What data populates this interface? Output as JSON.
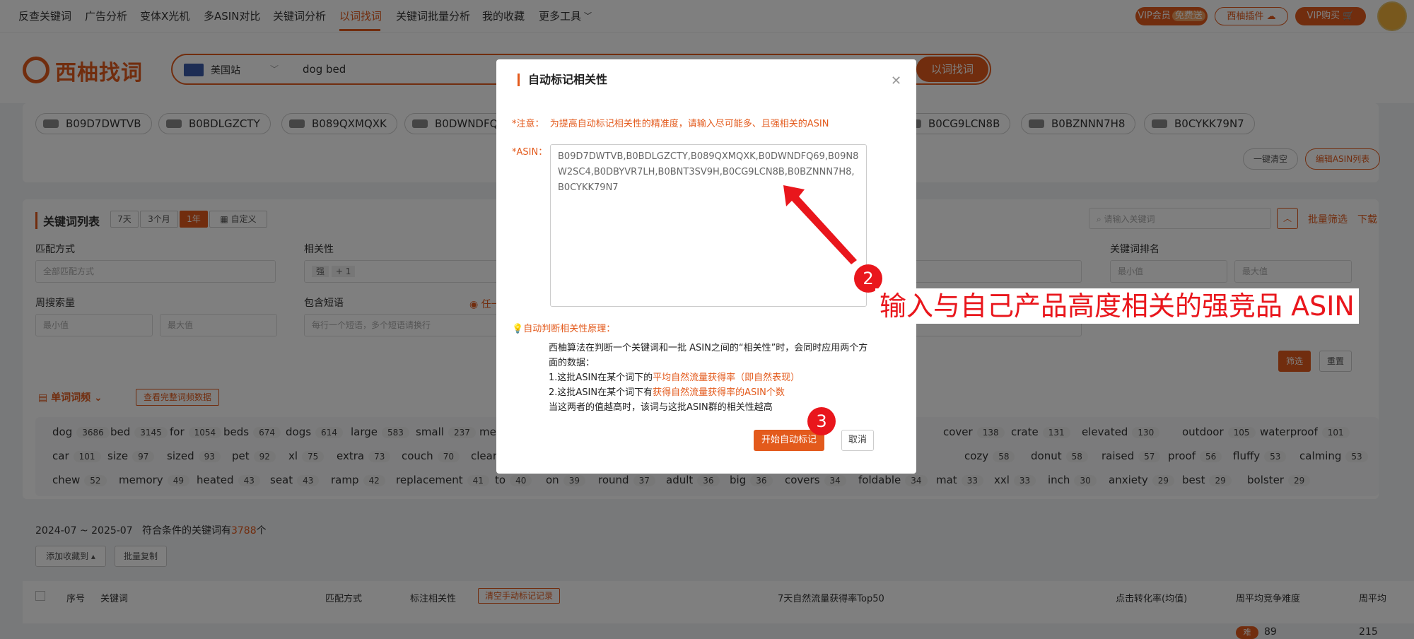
{
  "nav": {
    "items": [
      "反查关键词",
      "广告分析",
      "变体X光机",
      "多ASIN对比",
      "关键词分析",
      "以词找词",
      "关键词批量分析",
      "我的收藏",
      "更多工具"
    ],
    "vip_gift": "VIP会员",
    "vip_gift_badge": "免费送",
    "plugin": "西柚插件",
    "vip_buy": "VIP购买"
  },
  "header": {
    "logo_text": "西柚找词",
    "site": "美国站",
    "search_value": "dog bed",
    "search_button": "以词找词"
  },
  "asins": [
    "B09D7DWTVB",
    "B0BDLGZCTY",
    "B089QXMQXK",
    "B0DWNDFQ69",
    "B0CG9LCN8B",
    "B0BZNNN7H8",
    "B0CYKK79N7"
  ],
  "asin_actions": {
    "clear": "一键清空",
    "edit": "编辑ASIN列表"
  },
  "keyword_section": {
    "title": "关键词列表",
    "ranges": [
      "7天",
      "3个月",
      "1年",
      "自定义"
    ],
    "search_placeholder": "请输入关键词",
    "batch_filter": "批量筛选",
    "download": "下载",
    "match_label": "匹配方式",
    "match_value": "全部匹配方式",
    "relevance_label": "相关性",
    "relevance_tag": "强",
    "relevance_more": "+ 1",
    "rank_label": "关键词排名",
    "min_placeholder": "最小值",
    "max_placeholder": "最大值",
    "weekly_label": "周搜索量",
    "phrase_label": "包含短语",
    "phrase_placeholder": "每行一个短语，多个短语请换行",
    "radio_any": "任一",
    "filter_button": "筛选",
    "reset_button": "重置"
  },
  "word_freq": {
    "tab": "单词词频",
    "full_link": "查看完整词频数据",
    "rows": [
      [
        [
          "dog",
          "3686"
        ],
        [
          "bed",
          "3145"
        ],
        [
          "for",
          "1054"
        ],
        [
          "beds",
          "674"
        ],
        [
          "dogs",
          "614"
        ],
        [
          "large",
          "583"
        ],
        [
          "small",
          "237"
        ],
        [
          "me",
          ""
        ]
      ],
      [
        [
          "car",
          "101"
        ],
        [
          "size",
          "97"
        ],
        [
          "sized",
          "93"
        ],
        [
          "pet",
          "92"
        ],
        [
          "xl",
          "75"
        ],
        [
          "extra",
          "73"
        ],
        [
          "couch",
          "70"
        ],
        [
          "clear",
          ""
        ]
      ],
      [
        [
          "chew",
          "52"
        ],
        [
          "memory",
          "49"
        ],
        [
          "heated",
          "43"
        ],
        [
          "seat",
          "43"
        ],
        [
          "ramp",
          "42"
        ],
        [
          "replacement",
          "41"
        ],
        [
          "to",
          "40"
        ],
        [
          "on",
          "39"
        ],
        [
          "round",
          "37"
        ],
        [
          "adult",
          "36"
        ],
        [
          "big",
          "36"
        ],
        [
          "covers",
          "34"
        ],
        [
          "foldable",
          "34"
        ],
        [
          "mat",
          "33"
        ],
        [
          "xxl",
          "33"
        ],
        [
          "inch",
          "30"
        ],
        [
          "anxiety",
          "29"
        ],
        [
          "best",
          "29"
        ],
        [
          "bolster",
          "29"
        ]
      ]
    ],
    "right_rows": [
      [
        [
          "cover",
          "138"
        ],
        [
          "crate",
          "131"
        ],
        [
          "elevated",
          "130"
        ],
        [
          "outdoor",
          "105"
        ],
        [
          "waterproof",
          "101"
        ]
      ],
      [
        [
          "cozy",
          "58"
        ],
        [
          "donut",
          "58"
        ],
        [
          "raised",
          "57"
        ],
        [
          "proof",
          "56"
        ],
        [
          "fluffy",
          "53"
        ],
        [
          "calming",
          "53"
        ]
      ]
    ]
  },
  "results": {
    "date_range": "2024-07 ~ 2025-07",
    "count_prefix": "符合条件的关键词有",
    "count": "3788",
    "count_suffix": "个",
    "add_fav": "添加收藏到",
    "batch_copy": "批量复制",
    "columns": [
      "序号",
      "关键词",
      "匹配方式",
      "标注相关性",
      "7天自然流量获得率Top50",
      "点击转化率(均值)",
      "周平均竞争难度",
      "周平均"
    ],
    "clear_manual": "清空手动标记记录",
    "row_badge": "难",
    "row_value": "89",
    "row_value2": "215"
  },
  "modal": {
    "title": "自动标记相关性",
    "note_label": "*注意：",
    "note_text": "为提高自动标记相关性的精准度，请输入尽可能多、且强相关的ASIN",
    "asin_label": "*ASIN：",
    "asin_value": "B09D7DWTVB,B0BDLGZCTY,B089QXMQXK,B0DWNDFQ69,B09N8W2SC4,B0DBYVR7LH,B0BNT3SV9H,B0CG9LCN8B,B0BZNNN7H8,B0CYKK79N7",
    "principle_label": "自动判断相关性原理：",
    "line1": "西柚算法在判断一个关键词和一批 ASIN之间的“相关性”时，会同时应用两个方面的数据：",
    "line2_a": "1.这批ASIN在某个词下的",
    "line2_hl": "平均自然流量获得率（即自然表现）",
    "line3_a": "2.这批ASIN在某个词下有",
    "line3_hl": "获得自然流量获得率的ASIN个数",
    "line4": "当这两者的值越高时，该词与这批ASIN群的相关性越高",
    "start_button": "开始自动标记",
    "cancel_button": "取消"
  },
  "annotations": {
    "step2": "2",
    "step3": "3",
    "callout": "输入与自己产品高度相关的强竞品 ASIN"
  },
  "colors": {
    "accent": "#e35a1c",
    "annotation_red": "#e9161c"
  }
}
